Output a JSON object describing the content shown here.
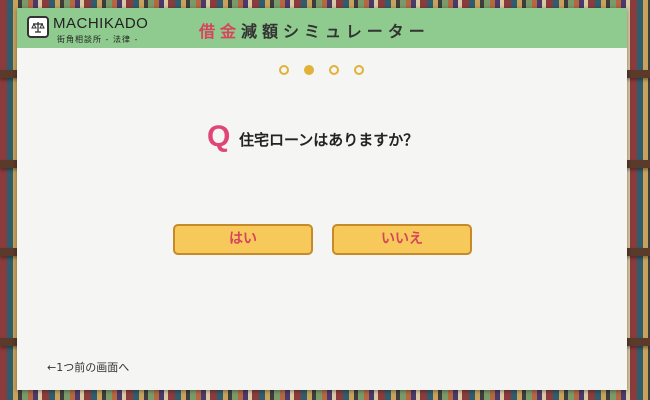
{
  "header": {
    "logo_name": "MACHIKADO",
    "logo_sub": "街角相談所 - 法律 -",
    "title_accent": "借金",
    "title_rest": "減額シミュレーター"
  },
  "progress": {
    "current_step": 2,
    "total_steps": 4
  },
  "question": {
    "mark": "Q",
    "text": "住宅ローンはありますか？"
  },
  "answers": {
    "yes_label": "はい",
    "no_label": "いいえ"
  },
  "footer": {
    "back_link": "←1つ前の画面へ"
  },
  "colors": {
    "header_bg": "#8fcb8f",
    "accent": "#d6455d",
    "button_bg": "#f7c85a",
    "button_border": "#c78a2a",
    "dot": "#e0b23a"
  }
}
